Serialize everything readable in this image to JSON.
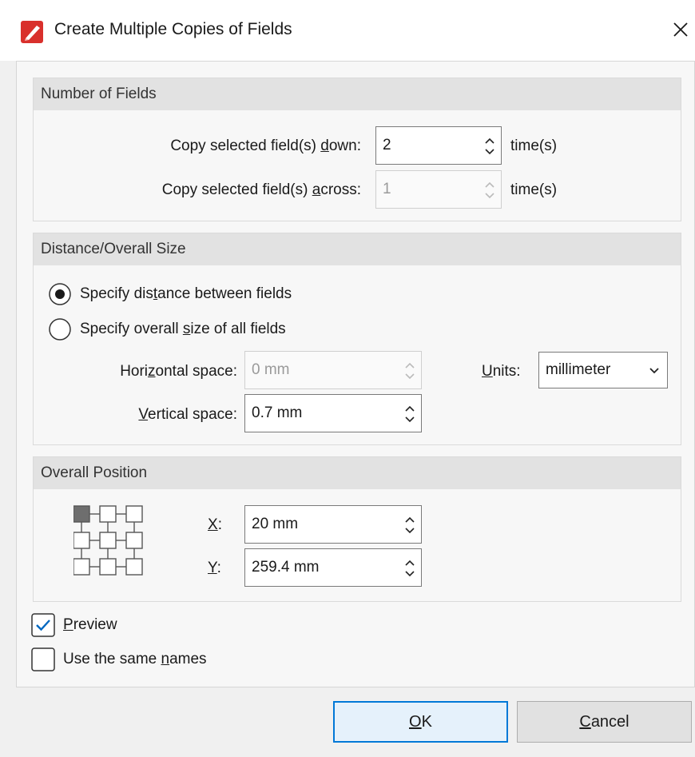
{
  "window": {
    "title": "Create Multiple Copies of Fields",
    "app_icon": "foxit-pen-icon",
    "close_label": "×"
  },
  "number_of_fields": {
    "heading": "Number of Fields",
    "down": {
      "label_pre": "Copy selected field(s) ",
      "label_ul": "d",
      "label_post": "own:",
      "value": "2",
      "unit": "time(s)",
      "enabled": true
    },
    "across": {
      "label_pre": "Copy selected field(s) ",
      "label_ul": "a",
      "label_post": "cross:",
      "value": "1",
      "unit": "time(s)",
      "enabled": false
    }
  },
  "distance": {
    "heading": "Distance/Overall Size",
    "radio_distance": {
      "label_pre": "Specify dis",
      "label_ul": "t",
      "label_post": "ance between fields",
      "selected": true
    },
    "radio_size": {
      "label_pre": "Specify overall ",
      "label_ul": "s",
      "label_post": "ize of all fields",
      "selected": false
    },
    "horizontal": {
      "label_pre": "Hori",
      "label_ul": "z",
      "label_post": "ontal space:",
      "value": "0 mm",
      "enabled": false
    },
    "vertical": {
      "label_pre": "",
      "label_ul": "V",
      "label_post": "ertical space:",
      "value": "0.7 mm",
      "enabled": true
    },
    "units": {
      "label_ul": "U",
      "label_post": "nits:",
      "value": "millimeter"
    }
  },
  "position": {
    "heading": "Overall Position",
    "grid_selected_index": 0,
    "x": {
      "label_ul": "X",
      "label_post": ":",
      "value": "20 mm"
    },
    "y": {
      "label_ul": "Y",
      "label_post": ":",
      "value": "259.4 mm"
    }
  },
  "options": {
    "preview": {
      "label_ul": "P",
      "label_post": "review",
      "checked": true
    },
    "same_names": {
      "label_pre": "Use the same ",
      "label_ul": "n",
      "label_post": "ames",
      "checked": false
    }
  },
  "buttons": {
    "ok": {
      "label_ul": "O",
      "label_post": "K"
    },
    "cancel": {
      "label_ul": "C",
      "label_post": "ancel"
    }
  },
  "colors": {
    "accent": "#0078d7",
    "group_header": "#e2e2e2",
    "title_icon": "#d9302c"
  }
}
